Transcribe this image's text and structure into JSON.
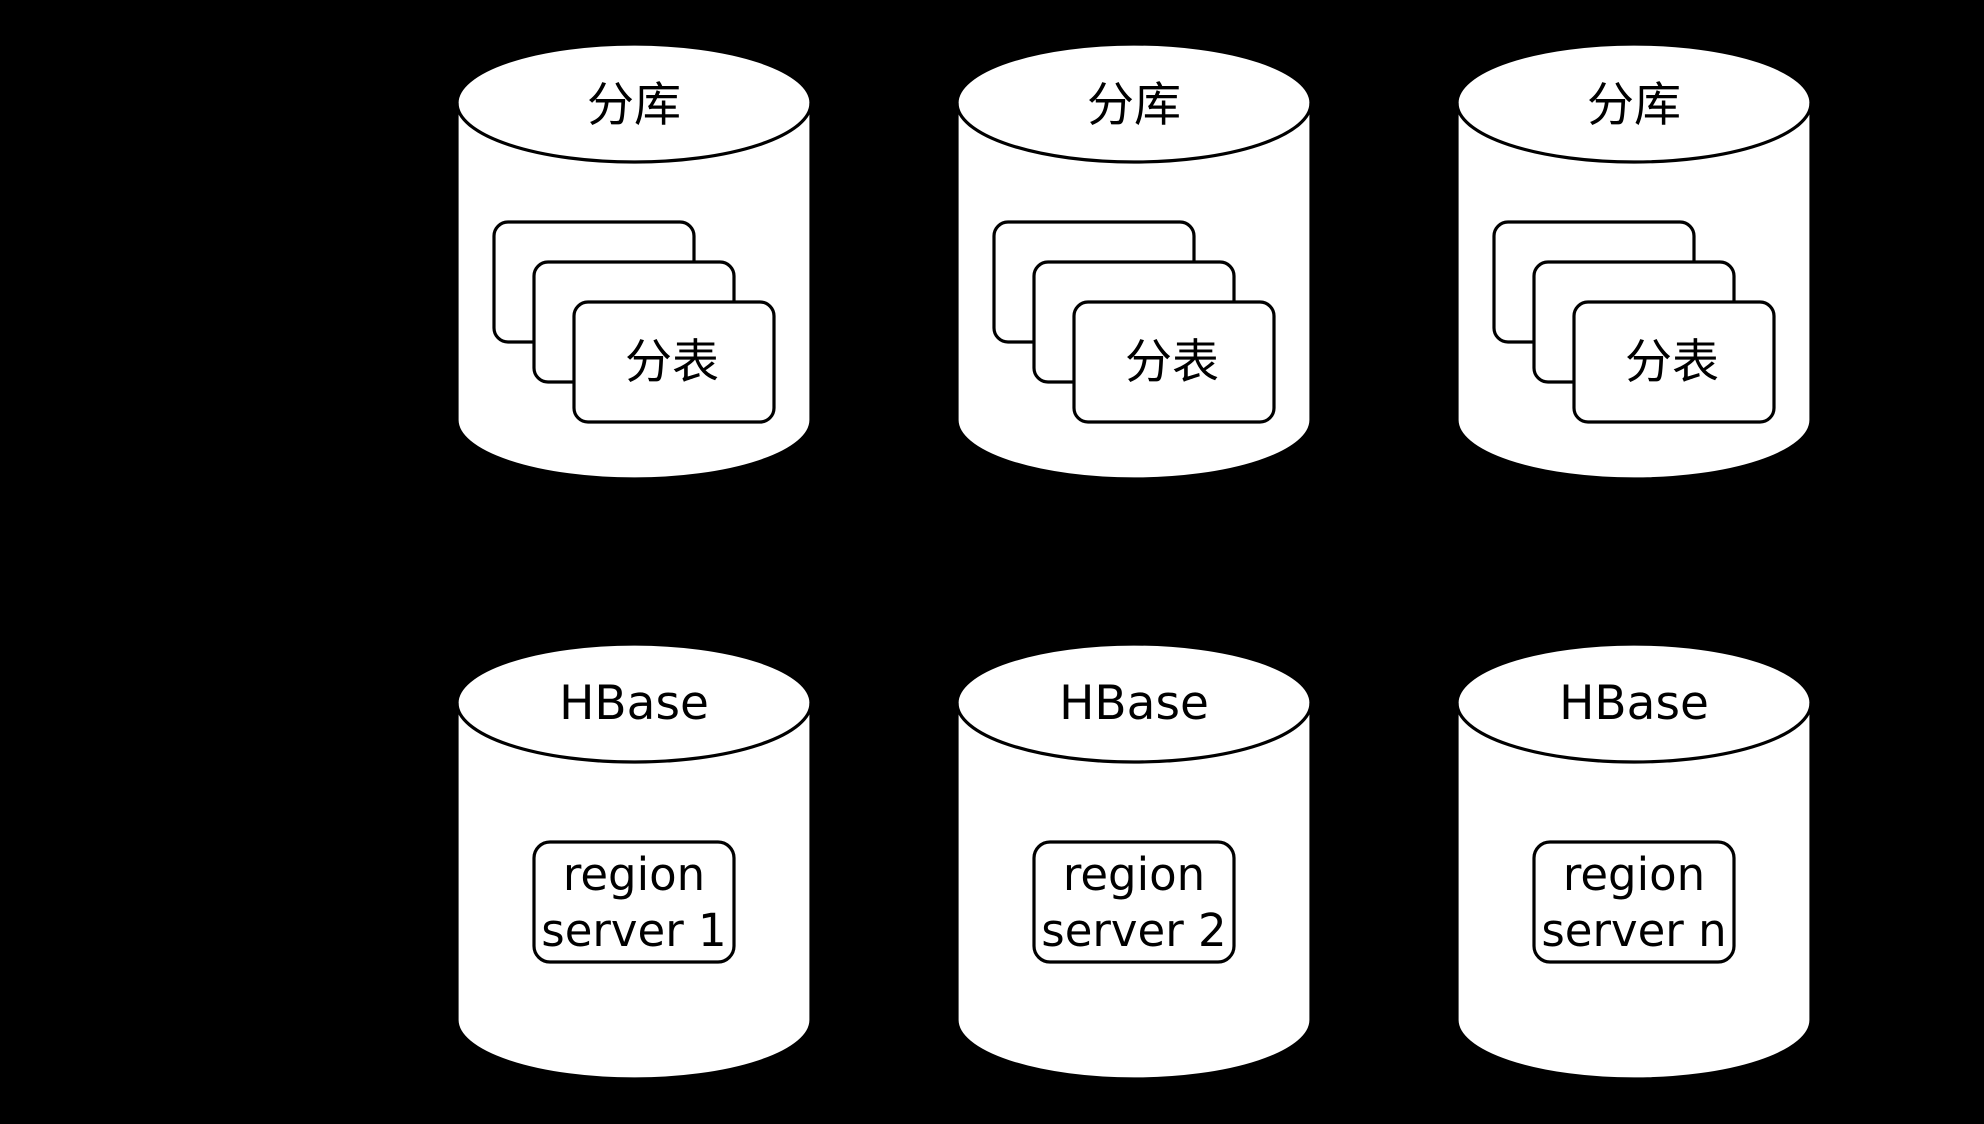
{
  "colors": {
    "background": "#000000",
    "shape_fill": "#ffffff",
    "stroke": "#000000"
  },
  "mysql_shards": [
    {
      "db_label": "分库",
      "table_label": "分表"
    },
    {
      "db_label": "分库",
      "table_label": "分表"
    },
    {
      "db_label": "分库",
      "table_label": "分表"
    }
  ],
  "hbase_nodes": [
    {
      "db_label": "HBase",
      "server_line1": "region",
      "server_line2": "server 1"
    },
    {
      "db_label": "HBase",
      "server_line1": "region",
      "server_line2": "server 2"
    },
    {
      "db_label": "HBase",
      "server_line1": "region",
      "server_line2": "server n"
    }
  ]
}
